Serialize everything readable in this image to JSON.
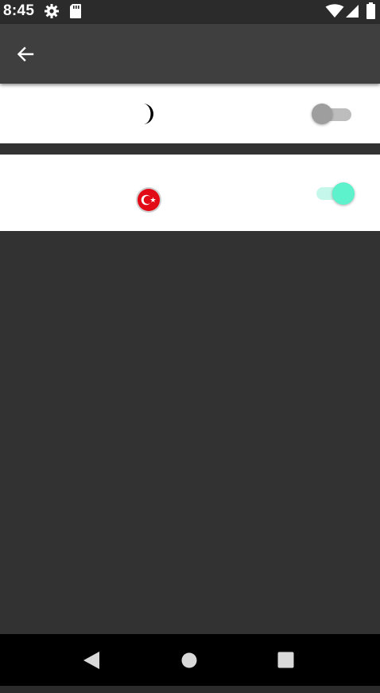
{
  "status_bar": {
    "time": "8:45",
    "icons": [
      "gear-icon",
      "sd-card-icon",
      "wifi-icon",
      "signal-icon",
      "battery-icon"
    ]
  },
  "app_bar": {
    "back_icon": "arrow-back-icon"
  },
  "settings": {
    "theme_toggle": {
      "icon": "moon-icon",
      "on": false
    },
    "language_toggle": {
      "icon": "turkey-flag-icon",
      "on": true
    }
  },
  "colors": {
    "accent": "#5ef2cc",
    "accent_track": "#c5f8ea",
    "switch_off_thumb": "#9e9e9e",
    "switch_off_track": "#bdbdbd",
    "app_bar": "#3f3f3f",
    "background": "#323232"
  },
  "nav_bar": {
    "icons": [
      "back-triangle-icon",
      "home-circle-icon",
      "recents-square-icon"
    ]
  }
}
